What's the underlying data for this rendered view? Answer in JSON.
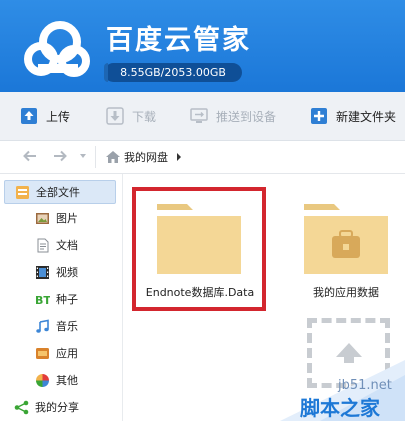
{
  "header": {
    "title": "百度云管家",
    "storage_text": "8.55GB/2053.00GB",
    "storage_used_fraction": 0.0042,
    "color": "#1b77d8"
  },
  "toolbar": {
    "upload_label": "上传",
    "download_label": "下载",
    "push_label": "推送到设备",
    "new_folder_label": "新建文件夹"
  },
  "nav": {
    "back_icon": "arrow-left-icon",
    "forward_icon": "arrow-right-icon",
    "breadcrumb_label": "我的网盘"
  },
  "sidebar": {
    "items": [
      {
        "label": "全部文件",
        "icon": "all-files-icon"
      },
      {
        "label": "图片",
        "icon": "picture-icon"
      },
      {
        "label": "文档",
        "icon": "document-icon"
      },
      {
        "label": "视频",
        "icon": "video-icon"
      },
      {
        "label": "种子",
        "icon": "bt-icon"
      },
      {
        "label": "音乐",
        "icon": "music-icon"
      },
      {
        "label": "应用",
        "icon": "app-icon"
      },
      {
        "label": "其他",
        "icon": "other-icon"
      },
      {
        "label": "我的分享",
        "icon": "share-icon"
      }
    ]
  },
  "content": {
    "folders": [
      {
        "name": "Endnote数据库.Data"
      },
      {
        "name": "我的应用数据"
      }
    ],
    "highlight_color": "#d3262e"
  },
  "watermark": {
    "site": "jb51.net",
    "text": "脚本之家"
  }
}
